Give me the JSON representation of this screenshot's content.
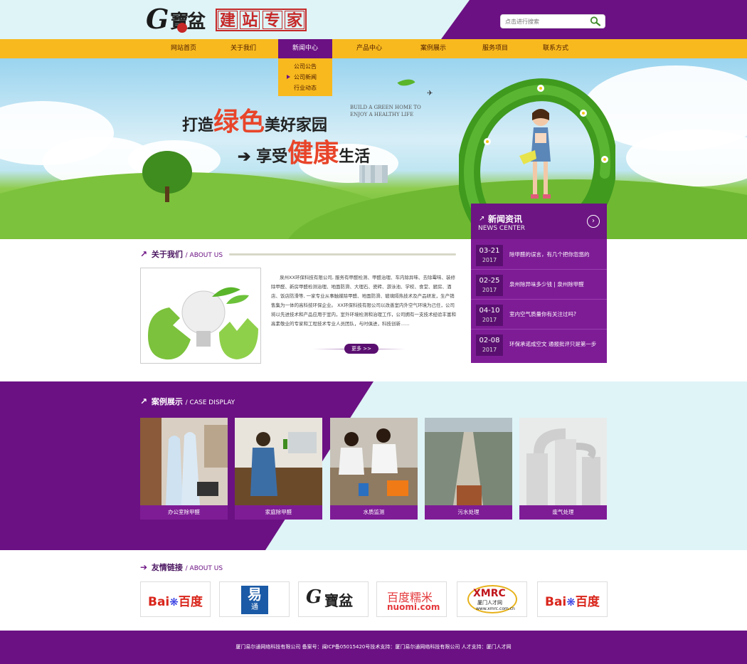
{
  "header": {
    "logo_letter": "G",
    "logo_name": "寶盆",
    "slogan": [
      "建",
      "站",
      "专",
      "家"
    ],
    "search": {
      "placeholder": "点击进行搜索"
    }
  },
  "nav": {
    "items": [
      {
        "label": "网站首页"
      },
      {
        "label": "关于我们"
      },
      {
        "label": "新闻中心"
      },
      {
        "label": "产品中心"
      },
      {
        "label": "案例展示"
      },
      {
        "label": "服务项目"
      },
      {
        "label": "联系方式"
      }
    ],
    "dropdown": [
      {
        "label": "公司公告"
      },
      {
        "label": "公司新闻"
      },
      {
        "label": "行业动态"
      }
    ]
  },
  "banner": {
    "line1_a": "打造",
    "line1_b": "绿色",
    "line1_c": "美好家园",
    "line2_a": "享受",
    "line2_b": "健康",
    "line2_c": "生活",
    "english": "BUILD A GREEN HOME TO ENJOY A HEALTHY LIFE"
  },
  "news": {
    "title": "新闻资讯",
    "subtitle": "NEWS CENTER",
    "items": [
      {
        "date": "03-21",
        "year": "2017",
        "title": "除甲醛的误言，有几个把你忽悠的"
      },
      {
        "date": "02-25",
        "year": "2017",
        "title": "泉州除异味多少钱 | 泉州除甲醛"
      },
      {
        "date": "04-10",
        "year": "2017",
        "title": "室内空气质量你有关注过吗?"
      },
      {
        "date": "02-08",
        "year": "2017",
        "title": "环保承诺成空文 通报批评只是第一步"
      }
    ]
  },
  "about": {
    "title": "关于我们",
    "en": "/ ABOUT US",
    "text": "泉州XX环保科技有限公司, 服务有甲醛检测、甲醛治理、车内除异味、去除霉味、装修除甲醛、新房甲醛检测治理、地面防滑、大理石、瓷砖、游泳池、学校、食堂、厨房、酒店、饭店防滑等, 一家专业从事触媒除甲醛、地面防滑、玻璃隔热技术及产品研发，生产销售集为一体的高科技环保企业。  XX环保科技有限公司以改善室内外空气环境为己任，公司将以先进技术和产品应用于室内，室外环境检测和治理工作，公司拥有一支技术经验丰富和高素敬业的专家和工程技术专业人员团队，与时俱进，科技创新......",
    "more": "更多 >>"
  },
  "cases": {
    "title": "案例展示",
    "en": "/ CASE DISPLAY",
    "items": [
      {
        "caption": "办公室除甲醛"
      },
      {
        "caption": "家庭除甲醛"
      },
      {
        "caption": "水质监测"
      },
      {
        "caption": "污水处理"
      },
      {
        "caption": "废气处理"
      }
    ]
  },
  "links": {
    "title": "友情链接",
    "en": "/ ABOUT US",
    "baidu_a": "Bai",
    "baidu_b": "百度",
    "yi": "易",
    "yi_sub": "通",
    "nuomi_cn": "百度糯米",
    "nuomi_en": "nuomi.com",
    "xmrc": "XMRC",
    "xmrc_sub": "厦门人才网",
    "xmrc_url": "www.xmrc.com.cn"
  },
  "footer": {
    "text": "厦门易尔通网络科技有限公司  备案号：闽ICP备05015420号技术支持：厦门易尔通网络科技有限公司  人才支持：厦门人才网"
  },
  "colors": {
    "purple": "#6b1183",
    "yellow": "#f8b91e",
    "light": "#dff4f7"
  }
}
